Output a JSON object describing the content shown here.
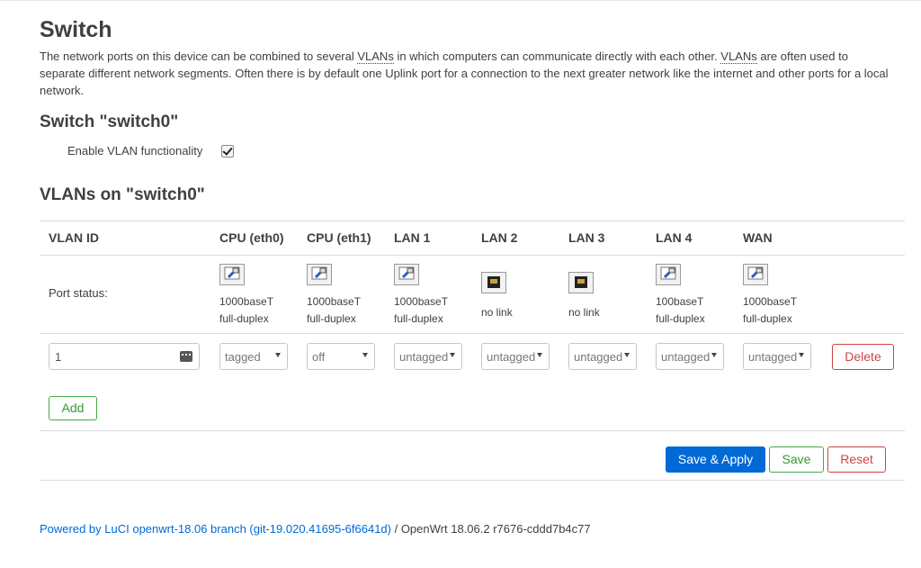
{
  "page": {
    "title": "Switch",
    "desc_part1": "The network ports on this device can be combined to several ",
    "desc_abbr1": "VLANs",
    "desc_part2": " in which computers can communicate directly with each other. ",
    "desc_abbr2": "VLANs",
    "desc_part3": " are often used to separate different network segments. Often there is by default one Uplink port for a connection to the next greater network like the internet and other ports for a local network."
  },
  "switch": {
    "heading": "Switch \"switch0\"",
    "enable_label": "Enable VLAN functionality",
    "enable_checked": true
  },
  "vlans": {
    "heading": "VLANs on \"switch0\"",
    "headers": [
      "VLAN ID",
      "CPU (eth0)",
      "CPU (eth1)",
      "LAN 1",
      "LAN 2",
      "LAN 3",
      "LAN 4",
      "WAN"
    ],
    "port_status_label": "Port status:",
    "ports": [
      {
        "line1": "1000baseT",
        "line2": "full-duplex",
        "link": true
      },
      {
        "line1": "1000baseT",
        "line2": "full-duplex",
        "link": true
      },
      {
        "line1": "1000baseT",
        "line2": "full-duplex",
        "link": true
      },
      {
        "line1": "no link",
        "line2": "",
        "link": false
      },
      {
        "line1": "no link",
        "line2": "",
        "link": false
      },
      {
        "line1": "100baseT",
        "line2": "full-duplex",
        "link": true
      },
      {
        "line1": "1000baseT",
        "line2": "full-duplex",
        "link": true
      }
    ],
    "row": {
      "vlan_id": "1",
      "selects": [
        "tagged",
        "off",
        "untagged",
        "untagged",
        "untagged",
        "untagged",
        "untagged"
      ]
    },
    "delete_label": "Delete",
    "add_label": "Add"
  },
  "actions": {
    "save_apply": "Save & Apply",
    "save": "Save",
    "reset": "Reset"
  },
  "footer": {
    "link_text": "Powered by LuCI openwrt-18.06 branch (git-19.020.41695-6f6641d)",
    "rest": " / OpenWrt 18.06.2 r7676-cddd7b4c77"
  },
  "colors": {
    "primary": "#0069d6",
    "positive": "#44aa44",
    "negative": "#cc4444"
  }
}
